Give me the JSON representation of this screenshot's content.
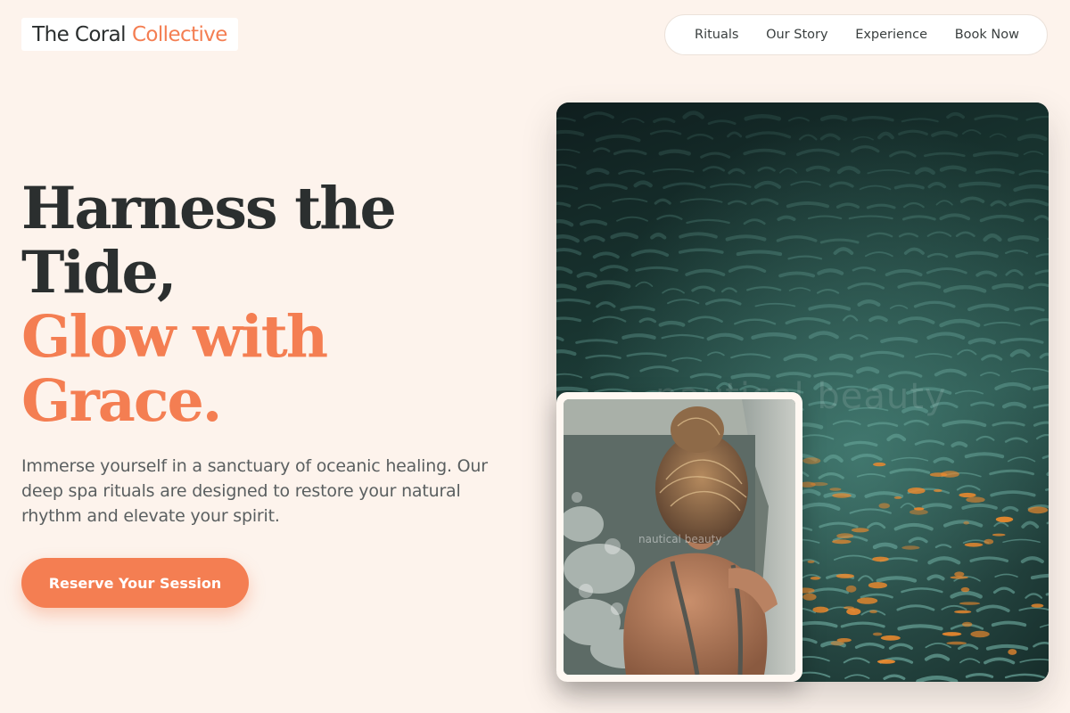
{
  "brand": {
    "name_part1": "The Coral",
    "name_part2": "Collective",
    "accent_color": "#f47e52",
    "text_color": "#2b2f2f"
  },
  "nav": {
    "items": [
      {
        "label": "Rituals"
      },
      {
        "label": "Our Story"
      },
      {
        "label": "Experience"
      },
      {
        "label": "Book Now"
      }
    ]
  },
  "hero": {
    "headline_line1": "Harness the",
    "headline_line2": "Tide,",
    "headline_accent_line1": "Glow with",
    "headline_accent_line2": "Grace.",
    "lead": "Immerse yourself in a sanctuary of oceanic healing. Our deep spa rituals are designed to restore your natural rhythm and elevate your spirit.",
    "cta_label": "Reserve Your Session"
  },
  "images": {
    "watermark_large": "nautical beauty",
    "watermark_small": "nautical beauty"
  },
  "colors": {
    "background": "#fdf3ec",
    "accent": "#f47e52",
    "water_dark": "#0e1c1c",
    "water_teal": "#3f7d74"
  }
}
